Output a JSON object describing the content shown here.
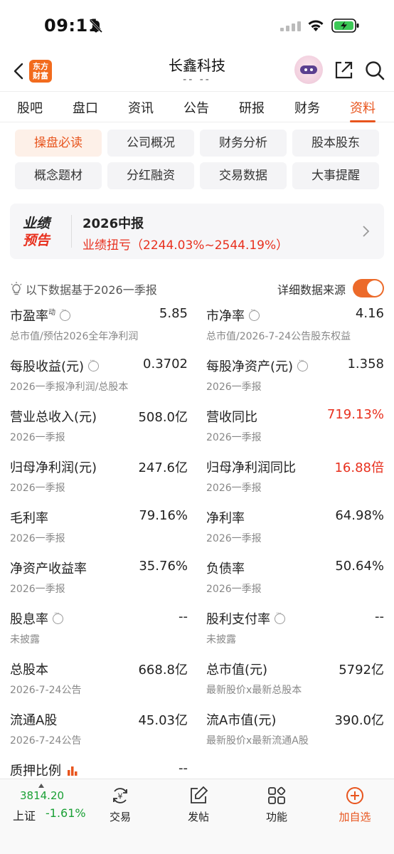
{
  "status_bar": {
    "time": "09:11"
  },
  "header": {
    "title": "长鑫科技",
    "subtitle": "-- --",
    "logo_line1": "东方",
    "logo_line2": "财富"
  },
  "tabs": [
    "股吧",
    "盘口",
    "资讯",
    "公告",
    "研报",
    "财务",
    "资料"
  ],
  "active_tab": "资料",
  "sub_tabs": [
    "操盘必读",
    "公司概况",
    "财务分析",
    "股本股东",
    "概念题材",
    "分红融资",
    "交易数据",
    "大事提醒"
  ],
  "active_sub_tab": "操盘必读",
  "banner": {
    "badge_line1": "业绩",
    "badge_line2": "预告",
    "report": "2026中报",
    "detail": "业绩扭亏（2244.03%~2544.19%）"
  },
  "data_basis": "以下数据基于2026一季报",
  "data_source_label": "详细数据来源",
  "data_source_on": true,
  "metrics": [
    {
      "label": "市盈率",
      "sup": "动",
      "info": true,
      "value": "5.85",
      "sub": "总市值/预估2026全年净利润"
    },
    {
      "label": "市净率",
      "info": true,
      "value": "4.16",
      "sub": "总市值/2026-7-24公告股东权益"
    },
    {
      "label": "每股收益(元)",
      "info": true,
      "value": "0.3702",
      "sub": "2026一季报净利润/总股本"
    },
    {
      "label": "每股净资产(元)",
      "info": true,
      "value": "1.358",
      "sub": "2026一季报"
    },
    {
      "label": "营业总收入(元)",
      "value": "508.0亿",
      "sub": "2026一季报"
    },
    {
      "label": "营收同比",
      "value": "719.13%",
      "red": true,
      "sub": "2026一季报"
    },
    {
      "label": "归母净利润(元)",
      "value": "247.6亿",
      "sub": "2026一季报"
    },
    {
      "label": "归母净利润同比",
      "value": "16.88倍",
      "red": true,
      "sub": "2026一季报"
    },
    {
      "label": "毛利率",
      "value": "79.16%",
      "sub": "2026一季报"
    },
    {
      "label": "净利率",
      "value": "64.98%",
      "sub": "2026一季报"
    },
    {
      "label": "净资产收益率",
      "value": "35.76%",
      "sub": "2026一季报"
    },
    {
      "label": "负债率",
      "value": "50.64%",
      "sub": "2026一季报"
    },
    {
      "label": "股息率",
      "info": true,
      "value": "--",
      "sub": "未披露"
    },
    {
      "label": "股利支付率",
      "info": true,
      "value": "--",
      "sub": "未披露"
    },
    {
      "label": "总股本",
      "value": "668.8亿",
      "sub": "2026-7-24公告"
    },
    {
      "label": "总市值(元)",
      "value": "5792亿",
      "sub": "最新股价x最新总股本"
    },
    {
      "label": "流通A股",
      "value": "45.03亿",
      "sub": "2026-7-24公告"
    },
    {
      "label": "流A市值(元)",
      "value": "390.0亿",
      "sub": "最新股价x最新流通A股"
    },
    {
      "label": "质押比例",
      "bars": true,
      "value": "--",
      "sub": ""
    }
  ],
  "bottom_nav": {
    "index_value": "3814.20",
    "index_name": "上证",
    "index_change": "-1.61%",
    "items": [
      "交易",
      "发帖",
      "功能",
      "加自选"
    ]
  },
  "colors": {
    "accent": "#e8551e",
    "up": "#e8301e",
    "down": "#1aa035"
  }
}
